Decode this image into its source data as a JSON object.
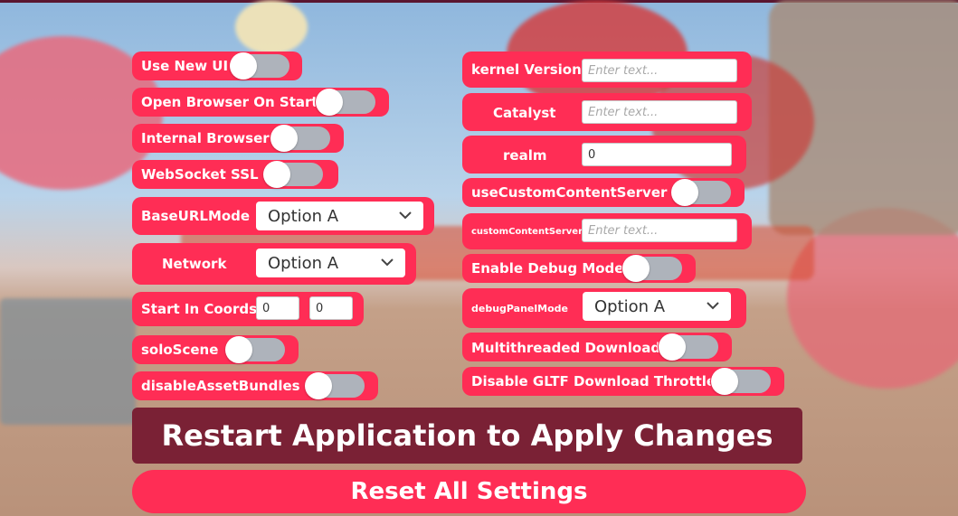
{
  "colors": {
    "accent": "#ff2d55",
    "restart_button": "#7a2135",
    "toggle_track": "#aeb3bb"
  },
  "left_panel": {
    "use_new_ui": {
      "label": "Use New UI",
      "on": false
    },
    "open_browser_on_start": {
      "label": "Open Browser On Start",
      "on": false
    },
    "internal_browser": {
      "label": "Internal Browser",
      "on": false
    },
    "websocket_ssl": {
      "label": "WebSocket SSL",
      "on": false
    },
    "base_url_mode": {
      "label": "BaseURLMode",
      "selected": "Option A"
    },
    "network": {
      "label": "Network",
      "selected": "Option A"
    },
    "start_in_coords": {
      "label": "Start In Coords",
      "x": "0",
      "y": "0"
    },
    "solo_scene": {
      "label": "soloScene",
      "on": false
    },
    "disable_asset_bundles": {
      "label": "disableAssetBundles",
      "on": false
    }
  },
  "right_panel": {
    "kernel_version": {
      "label": "kernel Version",
      "placeholder": "Enter text..."
    },
    "catalyst": {
      "label": "Catalyst",
      "placeholder": "Enter text..."
    },
    "realm": {
      "label": "realm",
      "value": "0"
    },
    "use_custom_content_server": {
      "label": "useCustomContentServer",
      "on": false
    },
    "custom_content_server": {
      "label": "customContentServer",
      "placeholder": "Enter text..."
    },
    "enable_debug_mode": {
      "label": "Enable Debug Mode",
      "on": false
    },
    "debug_panel_mode": {
      "label": "debugPanelMode",
      "selected": "Option A"
    },
    "multithreaded_download": {
      "label": "Multithreaded Download",
      "on": false
    },
    "disable_gltf_download_throttle": {
      "label": "Disable GLTF Download Throttle",
      "on": false
    }
  },
  "actions": {
    "restart_label": "Restart Application to Apply Changes",
    "reset_label": "Reset All Settings"
  }
}
